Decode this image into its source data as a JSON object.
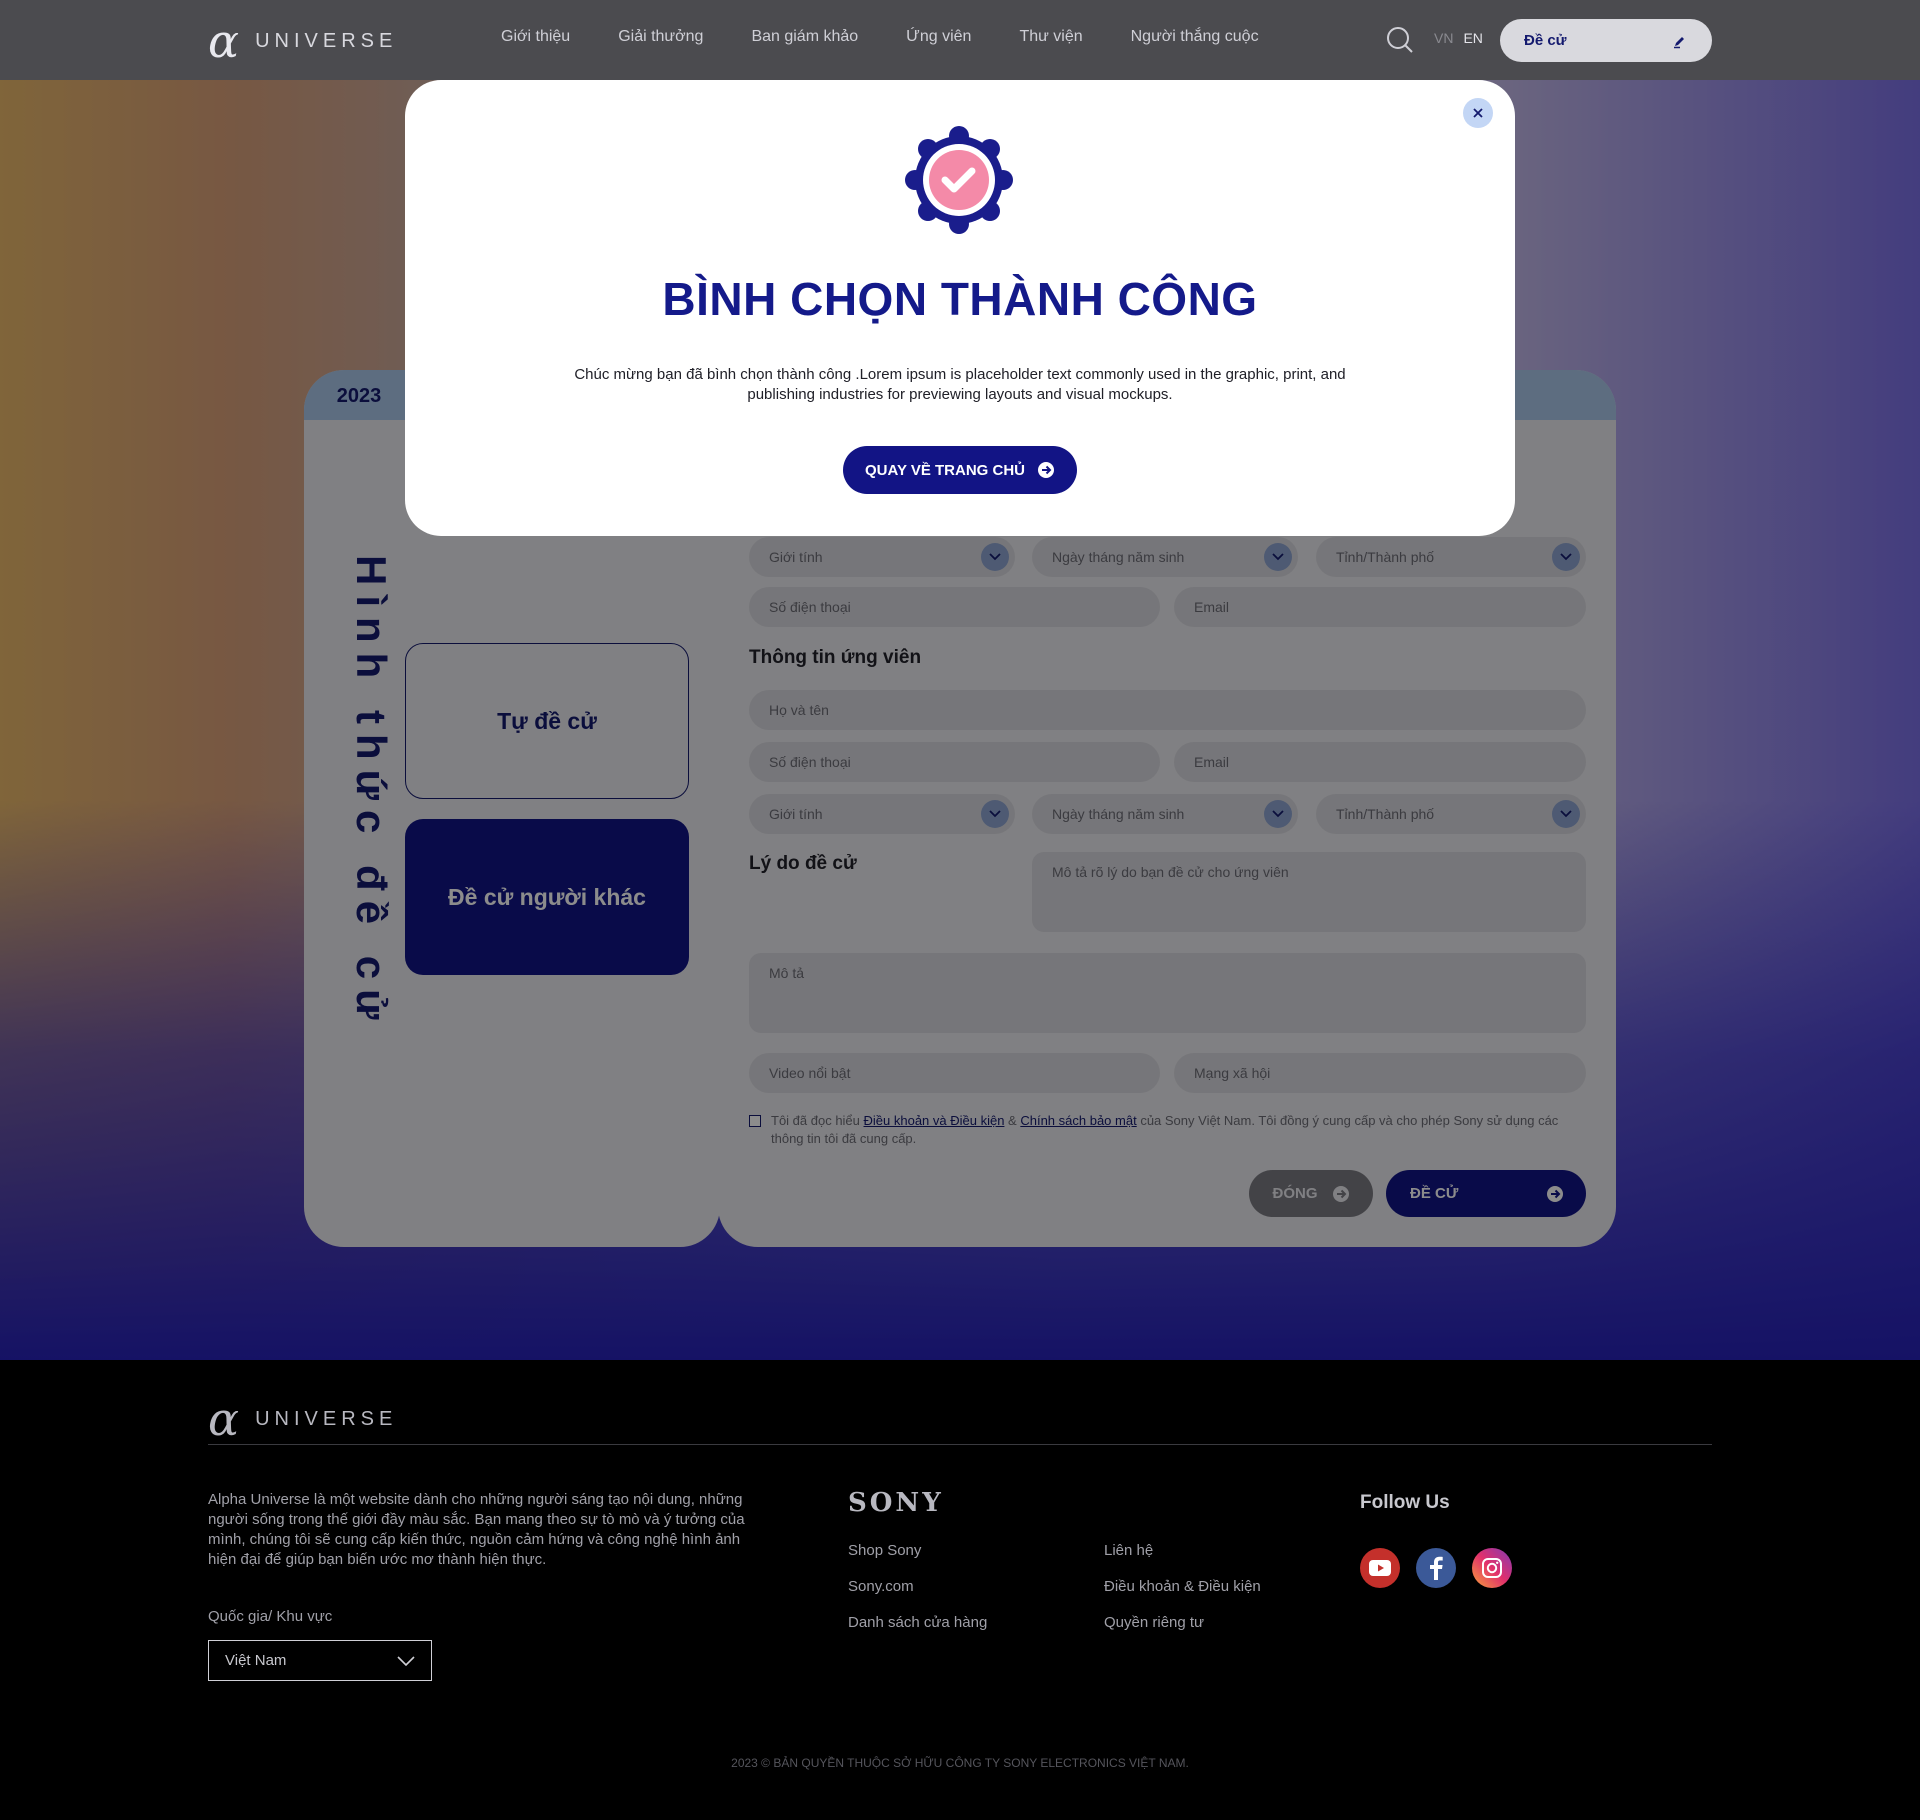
{
  "header": {
    "logo_word": "UNIVERSE",
    "nav": [
      "Giới thiệu",
      "Giải thưởng",
      "Ban giám khảo",
      "Ứng viên",
      "Thư viện",
      "Người thắng cuộc"
    ],
    "lang_vn": "VN",
    "lang_en": "EN",
    "nominate_label": "Đề cử"
  },
  "form": {
    "year": "2023",
    "vertical_title": "Hình thức đề cử",
    "option_self": "Tự đề cử",
    "option_other": "Đề cử người khác",
    "nominator": {
      "gender": "Giới tính",
      "dob": "Ngày tháng năm sinh",
      "city": "Tỉnh/Thành phố",
      "phone": "Số điện thoại",
      "email": "Email"
    },
    "candidate_title": "Thông tin ứng viên",
    "candidate": {
      "name": "Họ và tên",
      "phone": "Số điện thoại",
      "email": "Email",
      "gender": "Giới tính",
      "dob": "Ngày tháng năm sinh",
      "city": "Tỉnh/Thành phố"
    },
    "reason_title": "Lý do đề cử",
    "reason_placeholder": "Mô tả rõ lý do bạn đề cử cho ứng viên",
    "description_placeholder": "Mô tả",
    "video_placeholder": "Video nổi bật",
    "social_placeholder": "Mạng xã hội",
    "agree_pre": "Tôi đã đọc hiểu ",
    "agree_terms": "Điều khoản và Điều kiện",
    "agree_amp": " & ",
    "agree_privacy": "Chính sách bảo mật",
    "agree_post": " của Sony Việt Nam. Tôi đồng ý cung cấp và cho phép Sony sử dụng các thông tin tôi đã cung cấp.",
    "close_label": "ĐÓNG",
    "submit_label": "ĐỀ CỬ"
  },
  "modal": {
    "title": "BÌNH CHỌN THÀNH CÔNG",
    "message_line1": "Chúc mừng bạn đã bình chọn thành công .Lorem ipsum is placeholder text commonly used in the graphic, print, and",
    "message_line2": "publishing industries for previewing layouts and visual mockups.",
    "home_button": "QUAY VỀ TRANG CHỦ"
  },
  "footer": {
    "logo_word": "UNIVERSE",
    "about": "Alpha Universe là một website dành cho những người sáng tạo nội dung, những người sống trong thế giới đầy màu sắc. Bạn mang theo sự tò mò và ý tưởng của mình, chúng tôi sẽ cung cấp kiến thức, nguồn cảm hứng và công nghệ hình ảnh hiện đại để giúp bạn biến ước mơ thành hiện thực.",
    "country_label": "Quốc gia/ Khu vực",
    "country_value": "Việt Nam",
    "sony": "SONY",
    "links_col1": [
      "Shop Sony",
      "Sony.com",
      "Danh sách cửa hàng"
    ],
    "links_col2": [
      "Liên hệ",
      "Điều khoản & Điều kiện",
      "Quyền riêng tư"
    ],
    "follow_title": "Follow Us",
    "copyright": "2023 © BẢN QUYỀN THUỘC SỞ HỮU CÔNG TY SONY ELECTRONICS VIỆT NAM."
  },
  "colors": {
    "brand_navy": "#121485",
    "title_navy": "#141a8a",
    "badge_pink": "#f48aa8",
    "youtube": "#c4302b",
    "facebook": "#3b5998"
  }
}
